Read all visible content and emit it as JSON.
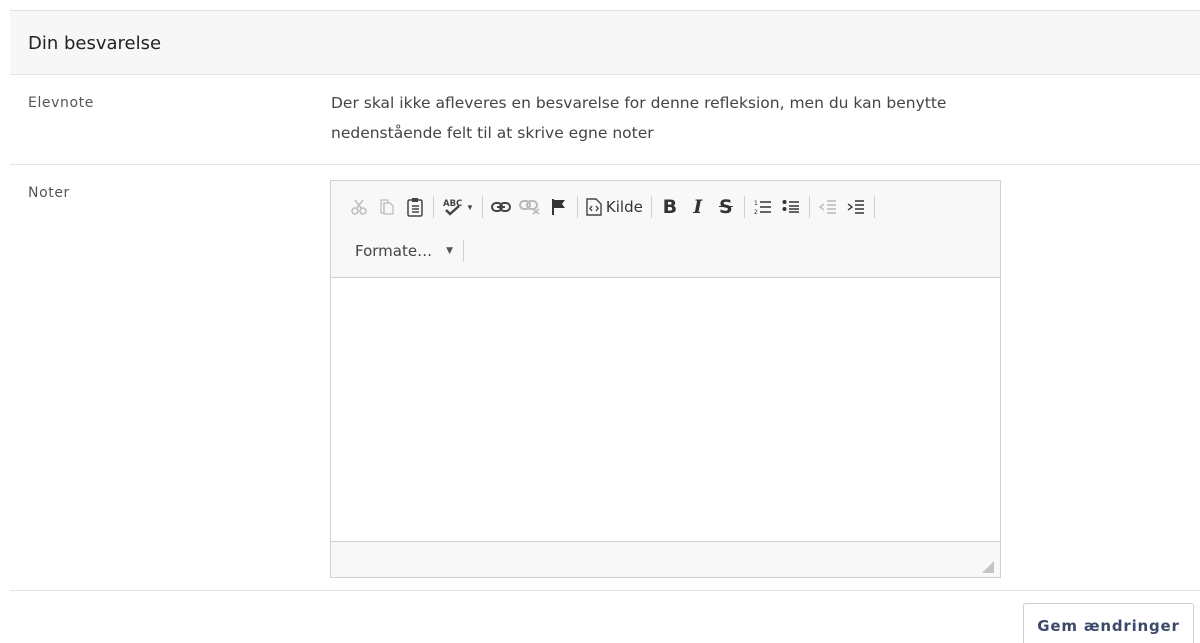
{
  "section": {
    "title": "Din besvarelse"
  },
  "elevnote": {
    "label": "Elevnote",
    "text_line1": "Der skal ikke afleveres en besvarelse for denne refleksion, men du kan benytte",
    "text_line2": "nedenstående felt til at skrive egne noter"
  },
  "noter": {
    "label": "Noter",
    "content": ""
  },
  "toolbar": {
    "source_label": "Kilde",
    "bold_label": "B",
    "italic_label": "I",
    "strike_label": "S",
    "format_label": "Formate…",
    "icons": [
      "cut-icon",
      "copy-icon",
      "paste-icon",
      "spellcheck-icon",
      "link-icon",
      "unlink-icon",
      "anchor-icon",
      "source-icon",
      "numbered-list-icon",
      "bulleted-list-icon",
      "outdent-icon",
      "indent-icon"
    ]
  },
  "actions": {
    "save_label": "Gem ændringer"
  },
  "colors": {
    "border": "#e3e3e3",
    "header_bg": "#f7f7f7",
    "button_text": "#3b4a6b"
  }
}
